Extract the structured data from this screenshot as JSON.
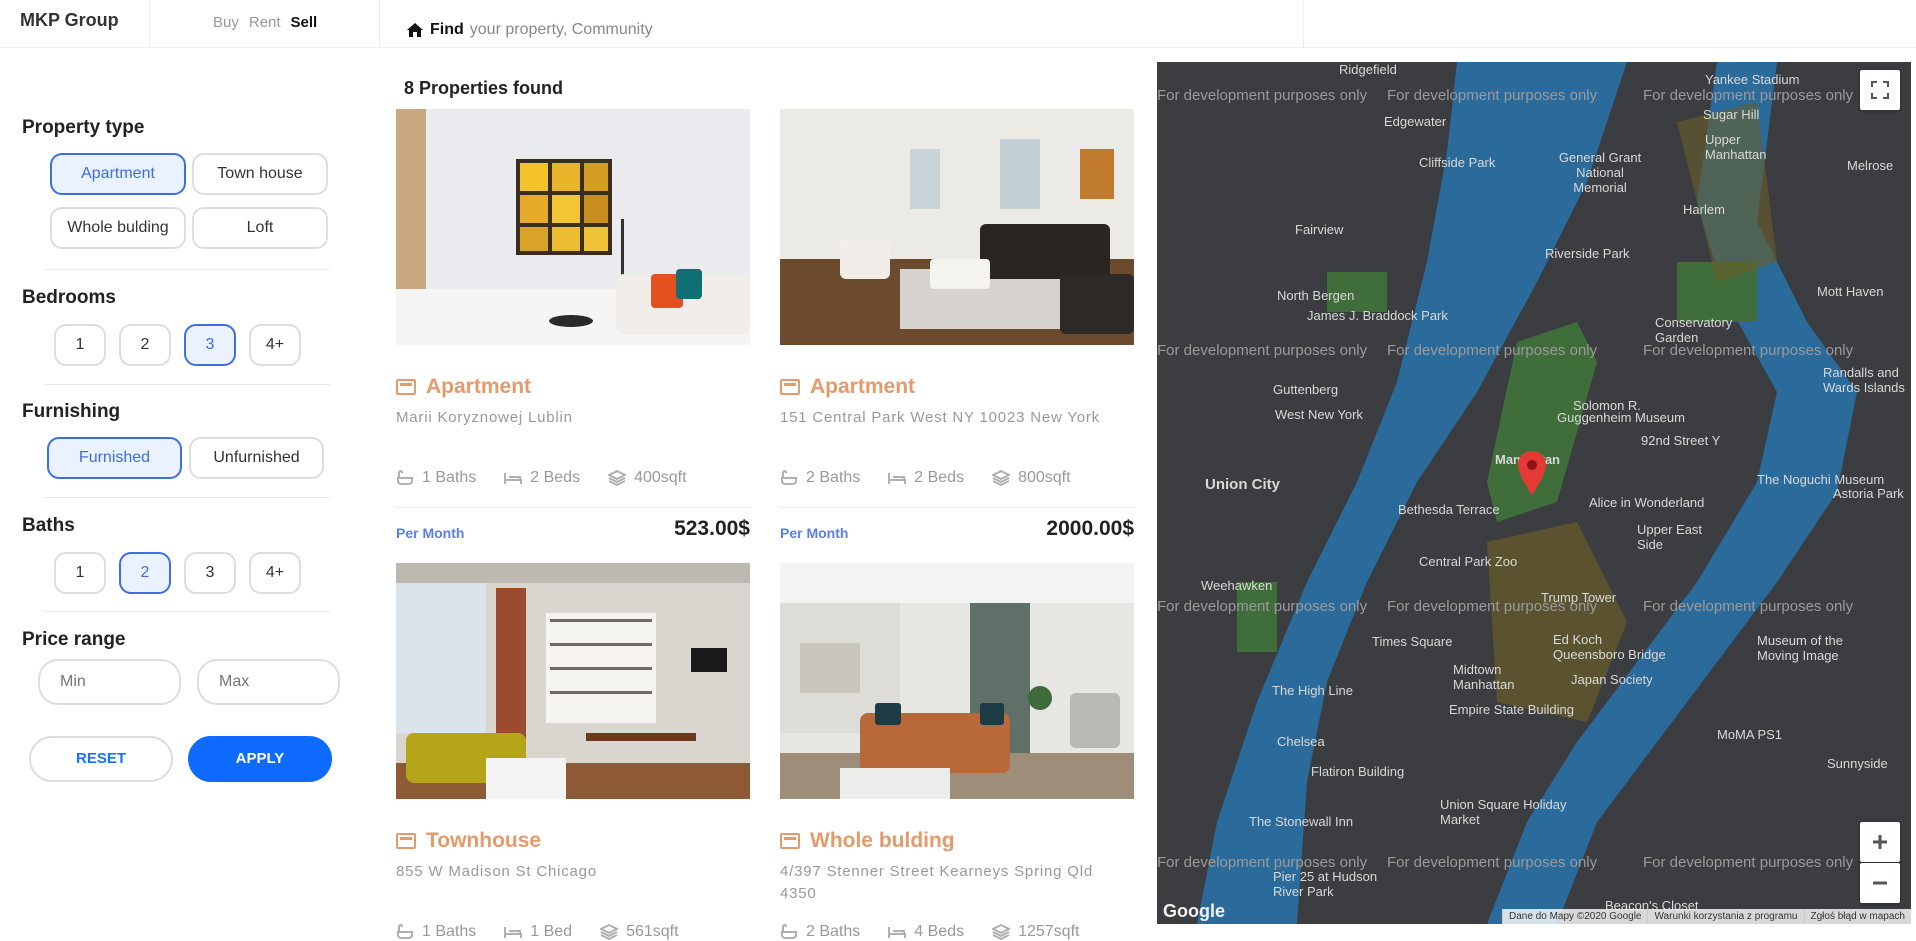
{
  "header": {
    "brand": "MKP Group",
    "modes": [
      "Buy",
      "Rent",
      "Sell"
    ],
    "active_mode": "Sell",
    "find_label": "Find",
    "search_placeholder": "your property, Community"
  },
  "filters": {
    "property_type": {
      "title": "Property type",
      "options": [
        "Apartment",
        "Town house",
        "Whole bulding",
        "Loft"
      ],
      "selected": "Apartment"
    },
    "bedrooms": {
      "title": "Bedrooms",
      "options": [
        "1",
        "2",
        "3",
        "4+"
      ],
      "selected": "3"
    },
    "furnishing": {
      "title": "Furnishing",
      "options": [
        "Furnished",
        "Unfurnished"
      ],
      "selected": "Furnished"
    },
    "baths": {
      "title": "Baths",
      "options": [
        "1",
        "2",
        "3",
        "4+"
      ],
      "selected": "2"
    },
    "price_range": {
      "title": "Price range",
      "min_placeholder": "Min",
      "max_placeholder": "Max"
    },
    "reset_label": "RESET",
    "apply_label": "APPLY"
  },
  "results": {
    "count_label": "8 Properties found",
    "listings": [
      {
        "type": "Apartment",
        "address": "Marii Koryznowej Lublin",
        "baths": "1 Baths",
        "beds": "2 Beds",
        "area": "400sqft",
        "period": "Per Month",
        "price": "523.00$"
      },
      {
        "type": "Apartment",
        "address": "151 Central Park West NY 10023 New York",
        "baths": "2 Baths",
        "beds": "2 Beds",
        "area": "800sqft",
        "period": "Per Month",
        "price": "2000.00$"
      },
      {
        "type": "Townhouse",
        "address": "855 W Madison St Chicago",
        "baths": "1 Baths",
        "beds": "1 Bed",
        "area": "561sqft"
      },
      {
        "type": "Whole bulding",
        "address": "4/397 Stenner Street Kearneys Spring Qld 4350",
        "baths": "2 Baths",
        "beds": "4 Beds",
        "area": "1257sqft"
      }
    ]
  },
  "map": {
    "dev_watermark": "For development purposes only",
    "places": [
      "Ridgefield",
      "Edgewater",
      "Cliffside Park",
      "Fairview",
      "North Bergen",
      "James J. Braddock Park",
      "Guttenberg",
      "West New York",
      "Union City",
      "Weehawken",
      "The High Line",
      "Chelsea",
      "Flatiron Building",
      "The Stonewall Inn",
      "Pier 25 at Hudson River Park",
      "Times Square",
      "Midtown Manhattan",
      "Empire State Building",
      "Union Square Holiday Market",
      "Central Park Zoo",
      "Bethesda Terrace",
      "Manhattan",
      "Alice in Wonderland",
      "Guggenheim Museum",
      "Solomon R.",
      "92nd Street Y",
      "Conservatory Garden",
      "Riverside Park",
      "Harlem",
      "General Grant National Memorial",
      "Upper Manhattan",
      "Sugar Hill",
      "Yankee Stadium",
      "Melrose",
      "Mott Haven",
      "Randalls and Wards Islands",
      "Astoria Park",
      "The Noguchi Museum",
      "Upper East Side",
      "Ed Koch Queensboro Bridge",
      "Japan Society",
      "Museum of the Moving Image",
      "MoMA PS1",
      "Sunnyside",
      "Beacon's Closet",
      "Trump Tower"
    ],
    "attribution": [
      "Dane do Mapy ©2020 Google",
      "Warunki korzystania z programu",
      "Zgłoś błąd w mapach"
    ],
    "logo": "Google"
  }
}
